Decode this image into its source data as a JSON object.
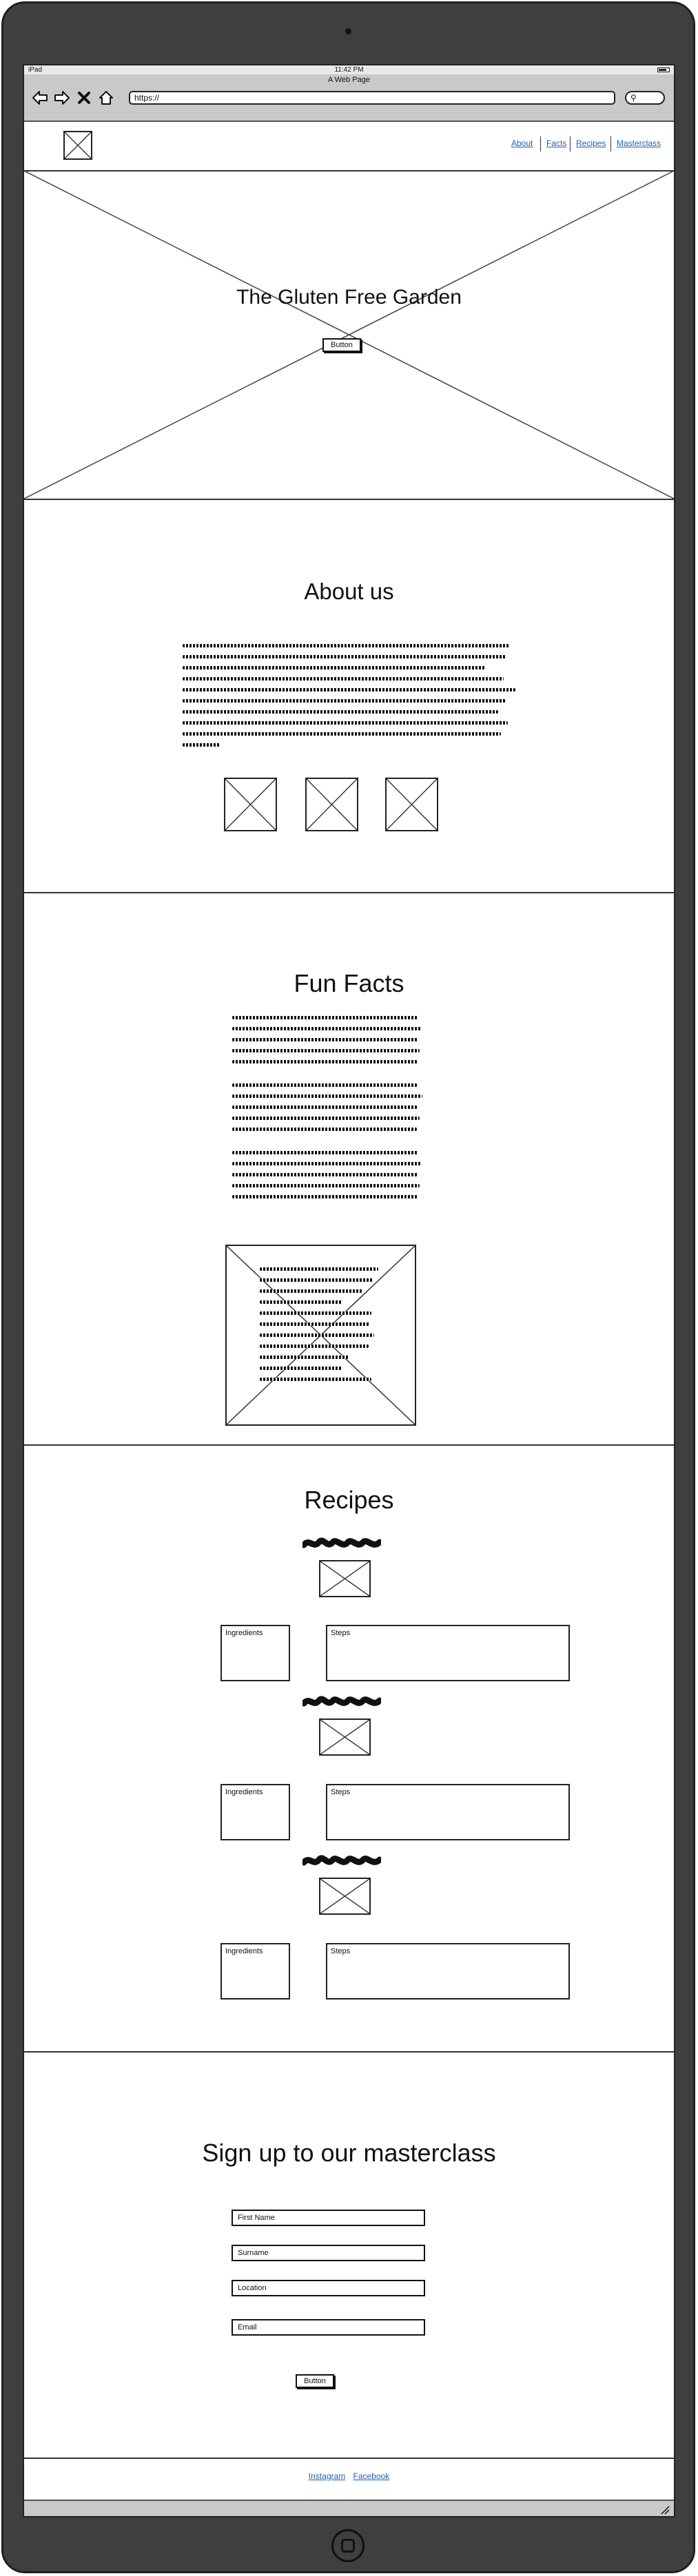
{
  "status_bar": {
    "device": "iPad",
    "time": "11:42 PM"
  },
  "browser": {
    "title": "A Web Page",
    "url": "https://",
    "search_glyph": "⚲"
  },
  "nav": {
    "links": [
      "About",
      "Facts",
      "Recipes",
      "Masterclass"
    ]
  },
  "hero": {
    "title": "The Gluten Free Garden",
    "button": "Button"
  },
  "about": {
    "title": "About us"
  },
  "facts": {
    "title": "Fun Facts"
  },
  "recipes": {
    "title": "Recipes",
    "items": [
      {
        "ingredients_label": "Ingredients",
        "steps_label": "Steps"
      },
      {
        "ingredients_label": "Ingredients",
        "steps_label": "Steps"
      },
      {
        "ingredients_label": "Ingredients",
        "steps_label": "Steps"
      }
    ]
  },
  "signup": {
    "title": "Sign up to our masterclass",
    "fields": [
      "First Name",
      "Surname",
      "Location",
      "Email"
    ],
    "button": "Button"
  },
  "footer": {
    "links": [
      "Instagram",
      "Facebook"
    ]
  },
  "colors": {
    "link": "#1f5fb0",
    "frame": "#3f3f3f",
    "toolbar": "#c9c9c9"
  }
}
